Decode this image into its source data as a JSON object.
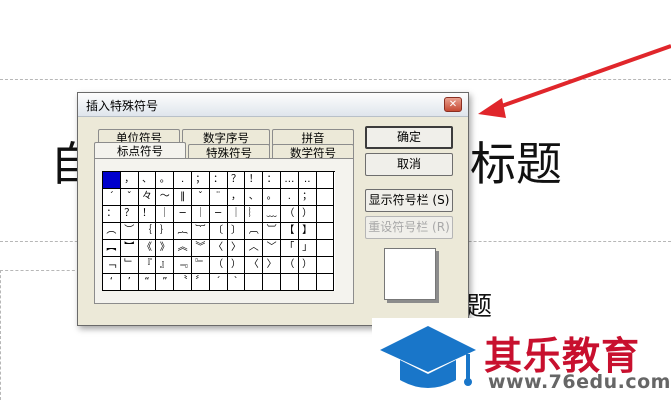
{
  "background": {
    "title_left": "自",
    "title_right": "标题",
    "sub_char": "题"
  },
  "dialog": {
    "title": "插入特殊符号",
    "close_glyph": "✕",
    "tabs_back": [
      "单位符号",
      "数字序号",
      "拼音"
    ],
    "tabs_front": [
      "标点符号",
      "特殊符号",
      "数学符号"
    ],
    "active_tab": "标点符号",
    "symbols": [
      "",
      "，",
      "、",
      "。",
      ".",
      "；",
      "：",
      "？",
      "！",
      "：",
      "…",
      "‥",
      "",
      "´",
      "ˇ",
      "々",
      "～",
      "‖",
      "ˇ",
      "¨",
      "，",
      "、",
      "。",
      ".",
      "；",
      "",
      "：",
      "？",
      "！",
      "｜",
      "─",
      "｜",
      "─",
      "｜",
      "︴",
      "﹏",
      "（",
      "）",
      "",
      "︵",
      "︶",
      "｛",
      "｝",
      "︷",
      "︸",
      "〔",
      "〕",
      "︹",
      "︺",
      "【",
      "】",
      "",
      "︻",
      "︼",
      "《",
      "》",
      "︽",
      "︾",
      "〈",
      "〉",
      "︿",
      "﹀",
      "「",
      "」",
      "",
      "﹁",
      "﹂",
      "『",
      "』",
      "﹃",
      "﹄",
      "（",
      "）",
      "〈",
      "〉",
      "（",
      "）",
      "",
      "‘",
      "’",
      "“",
      "”",
      "〝",
      "〞",
      "ˊ",
      "ˋ",
      "",
      "",
      "",
      "",
      ""
    ],
    "buttons": {
      "ok": "确定",
      "cancel": "取消",
      "show_bar": "显示符号栏 (S)",
      "reset_bar": "重设符号栏 (R)"
    }
  },
  "watermark": {
    "name": "其乐教育",
    "url": "www.76edu.com"
  },
  "colors": {
    "arrow": "#e0262b",
    "brand_red": "#c8102e",
    "brand_blue": "#1976c9",
    "selection": "#0000cc"
  }
}
